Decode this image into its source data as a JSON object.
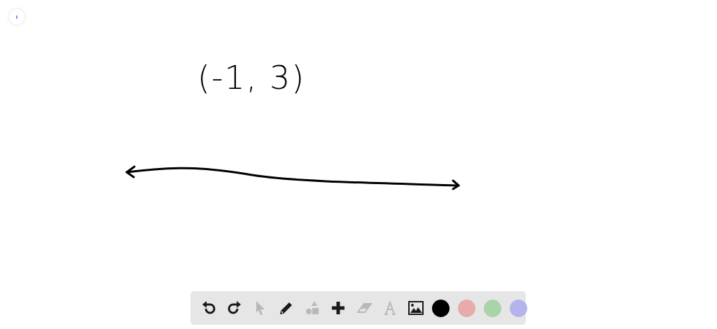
{
  "canvas": {
    "label": "(-1, 3)"
  },
  "toolbar": {
    "tools": [
      {
        "kind": "undo",
        "disabled": false
      },
      {
        "kind": "redo",
        "disabled": false
      },
      {
        "kind": "select",
        "disabled": true
      },
      {
        "kind": "pencil",
        "disabled": false
      },
      {
        "kind": "shapes",
        "disabled": true
      },
      {
        "kind": "add",
        "disabled": false
      },
      {
        "kind": "eraser",
        "disabled": true
      },
      {
        "kind": "text",
        "disabled": true
      },
      {
        "kind": "image",
        "disabled": false
      }
    ],
    "colors": [
      {
        "color": "#000000"
      },
      {
        "color": "#e8aaaa"
      },
      {
        "color": "#a9d3a9"
      },
      {
        "color": "#b3b3ee"
      }
    ]
  }
}
